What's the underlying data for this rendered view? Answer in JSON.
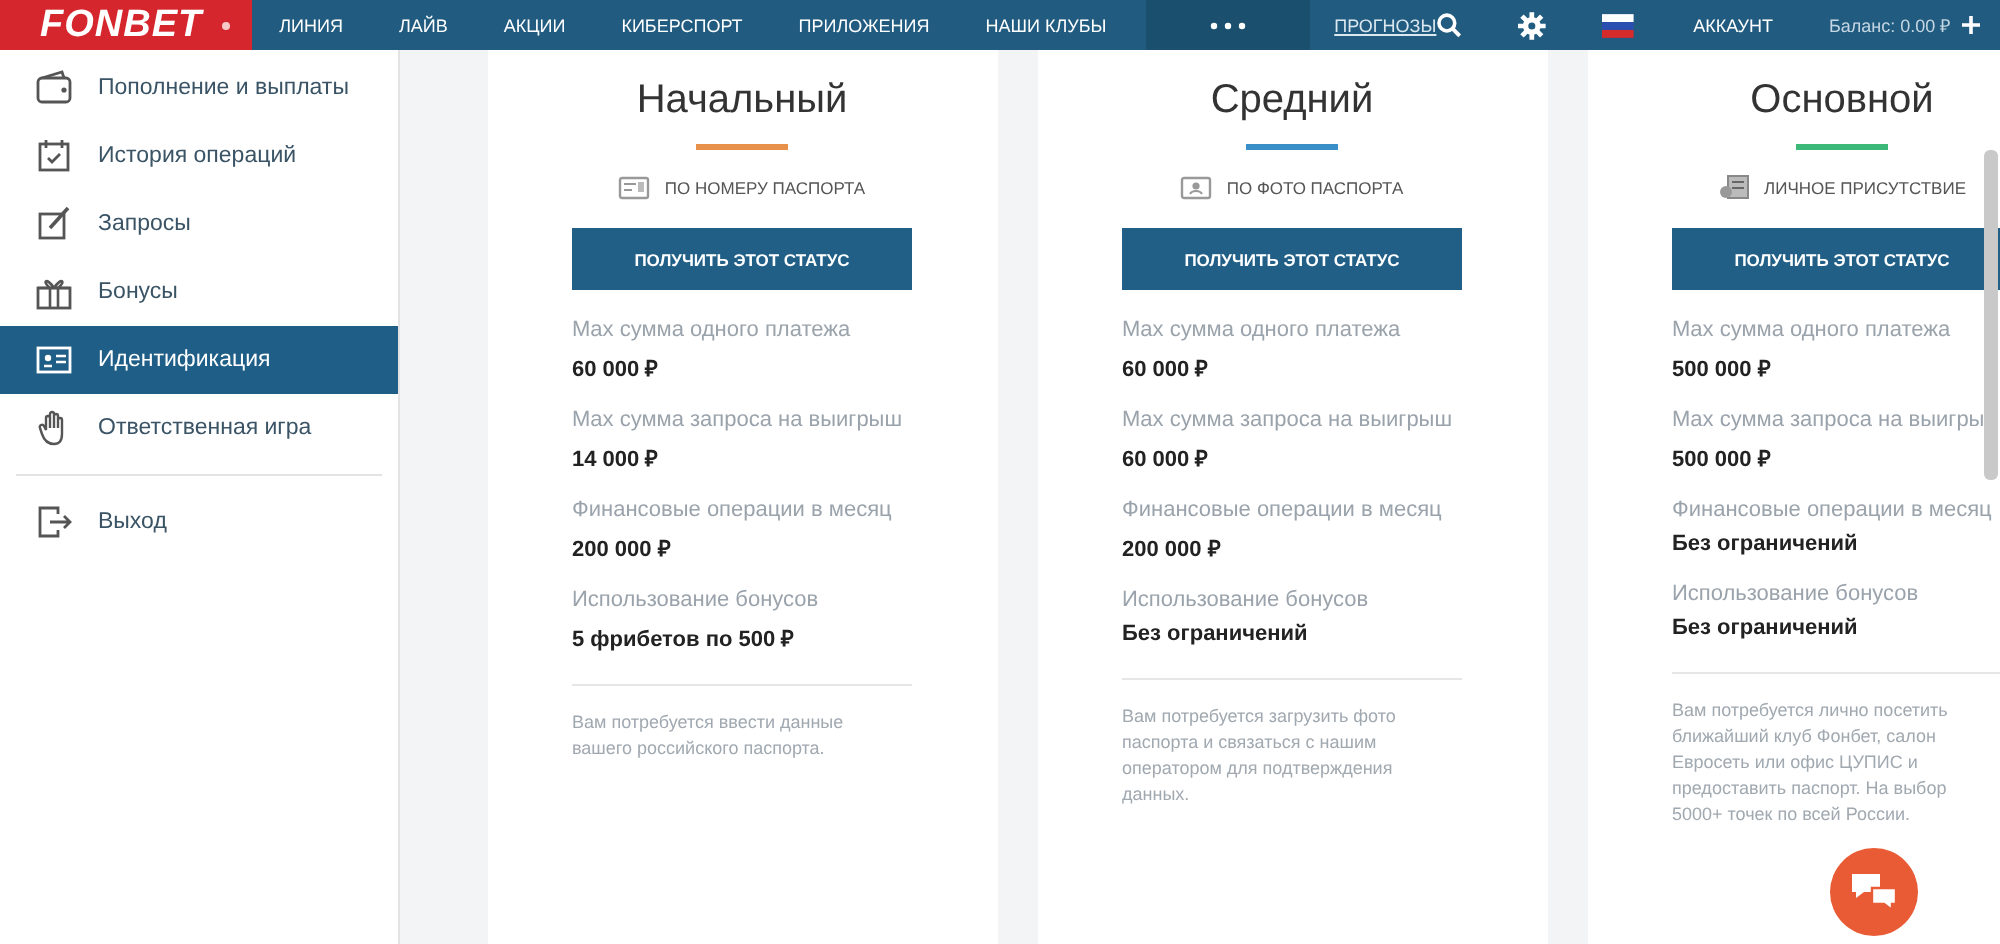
{
  "header": {
    "logo": "FONBET",
    "nav": [
      "ЛИНИЯ",
      "ЛАЙВ",
      "АКЦИИ",
      "КИБЕРСПОРТ",
      "ПРИЛОЖЕНИЯ",
      "НАШИ КЛУБЫ"
    ],
    "forecast_link": "ПРОГНОЗЫ",
    "account": "АККАУНТ",
    "balance": "Баланс: 0.00 ₽"
  },
  "sidebar": {
    "items": [
      {
        "label": "Пополнение и выплаты",
        "selected": false
      },
      {
        "label": "История операций",
        "selected": false
      },
      {
        "label": "Запросы",
        "selected": false
      },
      {
        "label": "Бонусы",
        "selected": false
      },
      {
        "label": "Идентификация",
        "selected": true
      },
      {
        "label": "Ответственная игра",
        "selected": false
      }
    ],
    "exit": "Выход"
  },
  "statuses": [
    {
      "title": "Начальный",
      "color": "#e8914a",
      "method": "ПО НОМЕРУ ПАСПОРТА",
      "button": "ПОЛУЧИТЬ ЭТОТ СТАТУС",
      "rows": [
        {
          "label": "Max сумма одного платежа",
          "value": "60 000 ₽"
        },
        {
          "label": "Max сумма запроса на выигрыш",
          "value": "14 000 ₽"
        },
        {
          "label": "Финансовые операции в месяц",
          "value": "200 000 ₽"
        },
        {
          "label": "Использование бонусов",
          "value": "5 фрибетов по 500 ₽"
        }
      ],
      "note": "Вам потребуется ввести данные вашего российского паспорта."
    },
    {
      "title": "Средний",
      "color": "#3a8fc8",
      "method": "ПО ФОТО ПАСПОРТА",
      "button": "ПОЛУЧИТЬ ЭТОТ СТАТУС",
      "rows": [
        {
          "label": "Max сумма одного платежа",
          "value": "60 000 ₽"
        },
        {
          "label": "Max сумма запроса на выигрыш",
          "value": "60 000 ₽"
        },
        {
          "label": "Финансовые операции в месяц",
          "value": "200 000 ₽"
        },
        {
          "label": "Использование бонусов",
          "value": "Без ограничений"
        }
      ],
      "note": "Вам потребуется загрузить фото паспорта и связаться с нашим оператором для подтверждения данных."
    },
    {
      "title": "Основной",
      "color": "#3cb878",
      "method": "ЛИЧНОЕ ПРИСУТСТВИЕ",
      "button": "ПОЛУЧИТЬ ЭТОТ СТАТУС",
      "rows": [
        {
          "label": "Max сумма одного платежа",
          "value": "500 000 ₽"
        },
        {
          "label": "Max сумма запроса на выигры",
          "value": "500 000 ₽"
        },
        {
          "label": "Финансовые операции в месяц",
          "value": "Без ограничений"
        },
        {
          "label": "Использование бонусов",
          "value": "Без ограничений"
        }
      ],
      "note": "Вам потребуется лично посетить ближайший клуб Фонбет, салон Евросеть или офис ЦУПИС и предоставить паспорт. На выбор 5000+ точек по всей России."
    }
  ]
}
